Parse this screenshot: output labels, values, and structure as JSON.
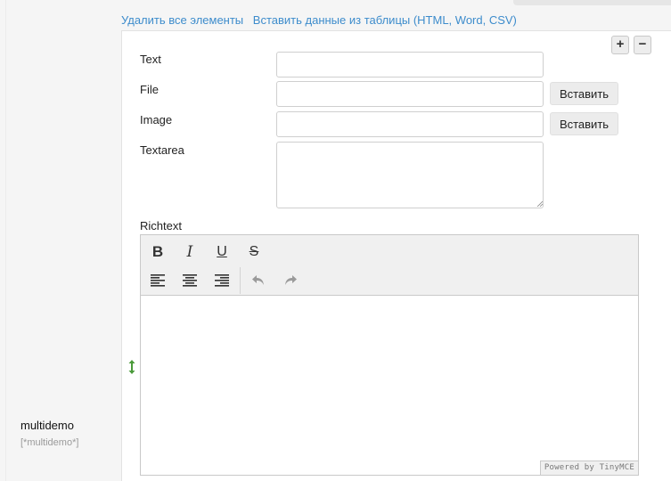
{
  "actions": {
    "delete_all": "Удалить все элементы",
    "paste_table": "Вставить данные из таблицы (HTML, Word, CSV)"
  },
  "controls": {
    "add_symbol": "+",
    "remove_symbol": "−"
  },
  "fields": {
    "text": {
      "label": "Text",
      "value": ""
    },
    "file": {
      "label": "File",
      "value": "",
      "button": "Вставить"
    },
    "image": {
      "label": "Image",
      "value": "",
      "button": "Вставить"
    },
    "textarea": {
      "label": "Textarea",
      "value": ""
    },
    "richtext": {
      "label": "Richtext"
    }
  },
  "editor": {
    "toolbar": {
      "bold": "B",
      "italic": "I",
      "underline": "U",
      "strikethrough": "S",
      "icons": [
        "align-left-icon",
        "align-center-icon",
        "align-right-icon",
        "undo-icon",
        "redo-icon"
      ]
    },
    "powered_by": "Powered by TinyMCE"
  },
  "field_caption": {
    "name": "multidemo",
    "key": "[*multidemo*]"
  },
  "colors": {
    "link": "#3d8ccc",
    "handle": "#4a9a3a",
    "toolbar_bg": "#f0f0f0"
  }
}
